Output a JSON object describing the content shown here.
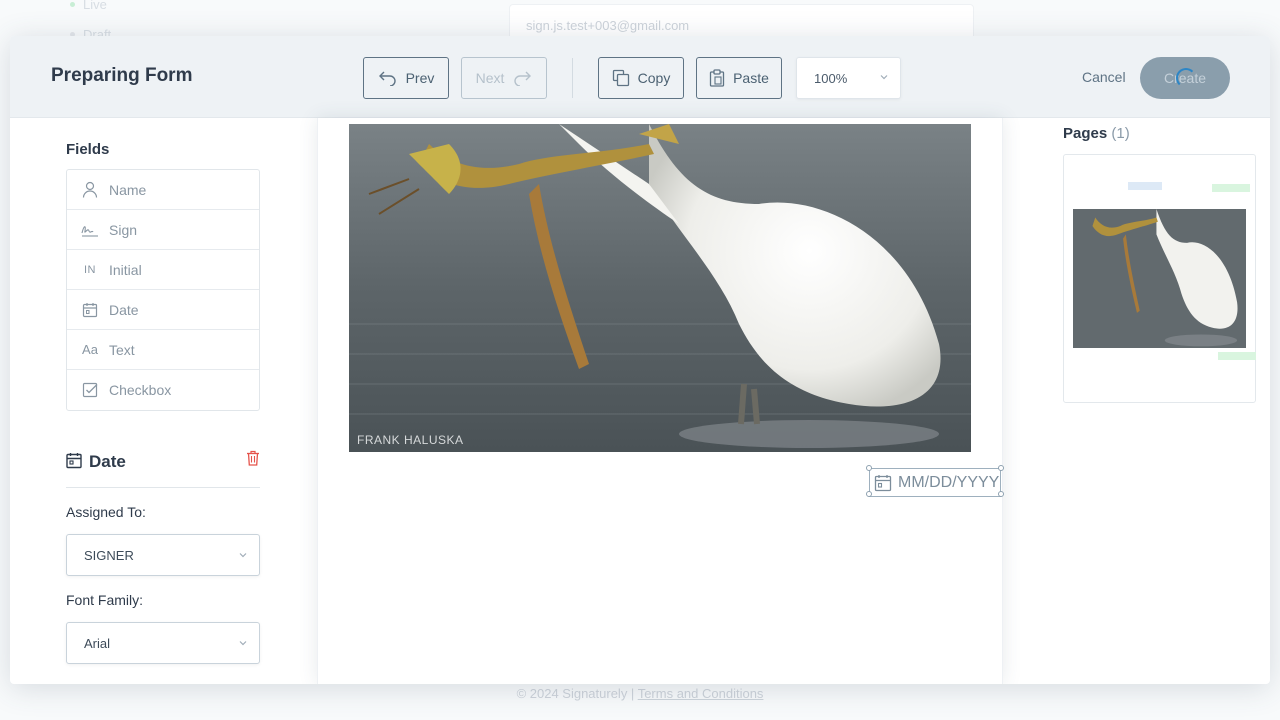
{
  "background": {
    "status_items": [
      "Live",
      "Draft"
    ],
    "email_value": "sign.js.test+003@gmail.com",
    "footer_copyright": "© 2024 Signaturely |",
    "footer_link": "Terms and Conditions"
  },
  "header": {
    "title": "Preparing Form",
    "prev_label": "Prev",
    "next_label": "Next",
    "copy_label": "Copy",
    "paste_label": "Paste",
    "zoom_value": "100%",
    "cancel_label": "Cancel",
    "create_label": "Create"
  },
  "fields_panel": {
    "title": "Fields",
    "items": [
      {
        "label": "Name",
        "icon": "user-icon"
      },
      {
        "label": "Sign",
        "icon": "signature-icon"
      },
      {
        "label": "Initial",
        "icon": "initial-icon"
      },
      {
        "label": "Date",
        "icon": "calendar-icon"
      },
      {
        "label": "Text",
        "icon": "text-icon"
      },
      {
        "label": "Checkbox",
        "icon": "checkbox-icon"
      }
    ]
  },
  "properties": {
    "field_type": "Date",
    "assigned_label": "Assigned To:",
    "assigned_value": "SIGNER",
    "font_family_label": "Font Family:",
    "font_family_value": "Arial"
  },
  "document": {
    "photo_credit": "FRANK HALUSKA",
    "date_placeholder": "MM/DD/YYYY"
  },
  "pages": {
    "title": "Pages",
    "count": "(1)"
  },
  "colors": {
    "accent": "#2d86c6",
    "header_bg": "#eef2f5",
    "button_border": "#5e7384",
    "create_bg": "#8a9eac",
    "danger": "#e5534b"
  }
}
